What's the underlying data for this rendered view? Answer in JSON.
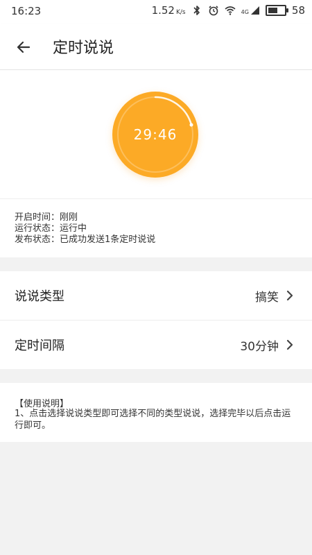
{
  "status_bar": {
    "time": "16:23",
    "speed": "1.52",
    "speed_unit": "K/s",
    "network": "4G",
    "battery": "58",
    "battery_level": 0.58
  },
  "header": {
    "title": "定时说说"
  },
  "timer": {
    "value": "29:46",
    "color": "#fcaa26"
  },
  "info": {
    "start_time": "开启时间：刚刚",
    "run_status": "运行状态：运行中",
    "publish_status": "发布状态：已成功发送1条定时说说"
  },
  "settings": [
    {
      "label": "说说类型",
      "value": "搞笑"
    },
    {
      "label": "定时间隔",
      "value": "30分钟"
    }
  ],
  "instructions": {
    "title": "【使用说明】",
    "body": "1、点击选择说说类型即可选择不同的类型说说，选择完毕以后点击运行即可。"
  }
}
